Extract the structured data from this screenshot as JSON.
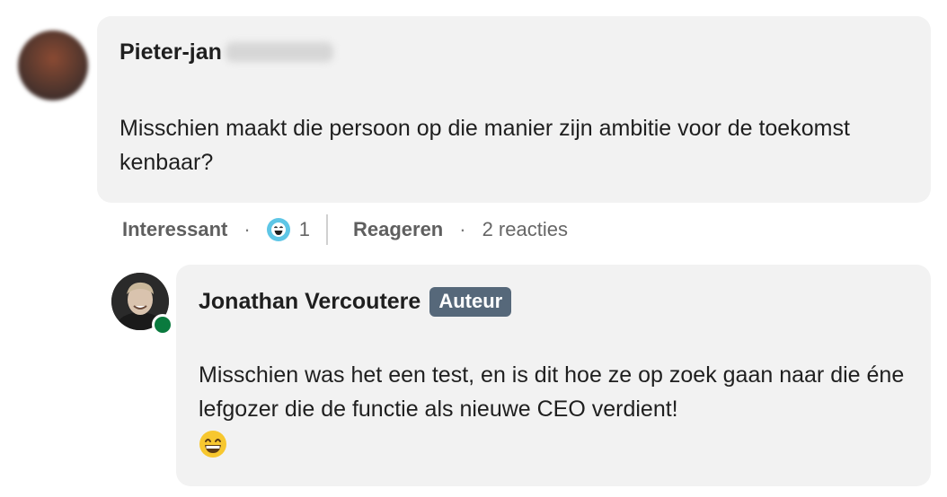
{
  "comment": {
    "author_name": "Pieter-jan",
    "text": "Misschien maakt die persoon op die manier zijn ambitie voor de toekomst kenbaar?",
    "actions": {
      "like_label": "Interessant",
      "separator": "·",
      "reaction_count": "1",
      "reply_label": "Reageren",
      "replies_count_label": "2 reacties"
    }
  },
  "reply": {
    "author_name": "Jonathan Vercoutere",
    "badge": "Auteur",
    "text": "Misschien was het een test, en is dit hoe ze op zoek gaan naar die éne lefgozer die de functie als nieuwe CEO verdient!",
    "online": true
  },
  "colors": {
    "bubble": "#f2f2f2",
    "badge": "#56687a",
    "online": "#0a7a3e",
    "reaction": "#5ec6e6"
  }
}
